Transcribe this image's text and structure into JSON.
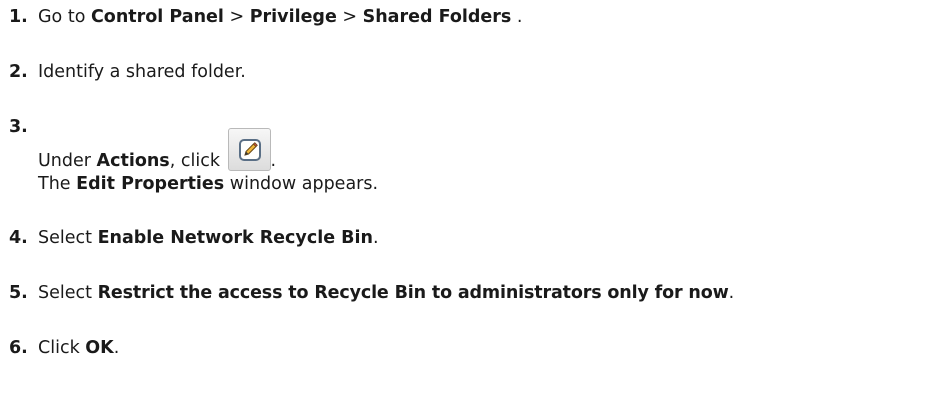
{
  "steps": [
    {
      "number": "1.",
      "parts": {
        "go_to": "Go to ",
        "control_panel": "Control Panel",
        "sep1": " > ",
        "privilege": "Privilege",
        "sep2": " > ",
        "shared_folders": "Shared Folders",
        "end": " ."
      }
    },
    {
      "number": "2.",
      "text": "Identify a shared folder."
    },
    {
      "number": "3.",
      "line1": {
        "under": "Under ",
        "actions": "Actions",
        "click": ", click ",
        "period": "."
      },
      "line2": {
        "the": "The ",
        "edit_properties": "Edit Properties",
        "rest": " window appears."
      },
      "button_icon": "edit-pencil-icon"
    },
    {
      "number": "4.",
      "select": "Select ",
      "option": "Enable Network Recycle Bin",
      "period": "."
    },
    {
      "number": "5.",
      "select": "Select ",
      "option": "Restrict the access to Recycle Bin to administrators only for now",
      "period": "."
    },
    {
      "number": "6.",
      "click": "Click ",
      "ok": "OK",
      "period": "."
    }
  ]
}
